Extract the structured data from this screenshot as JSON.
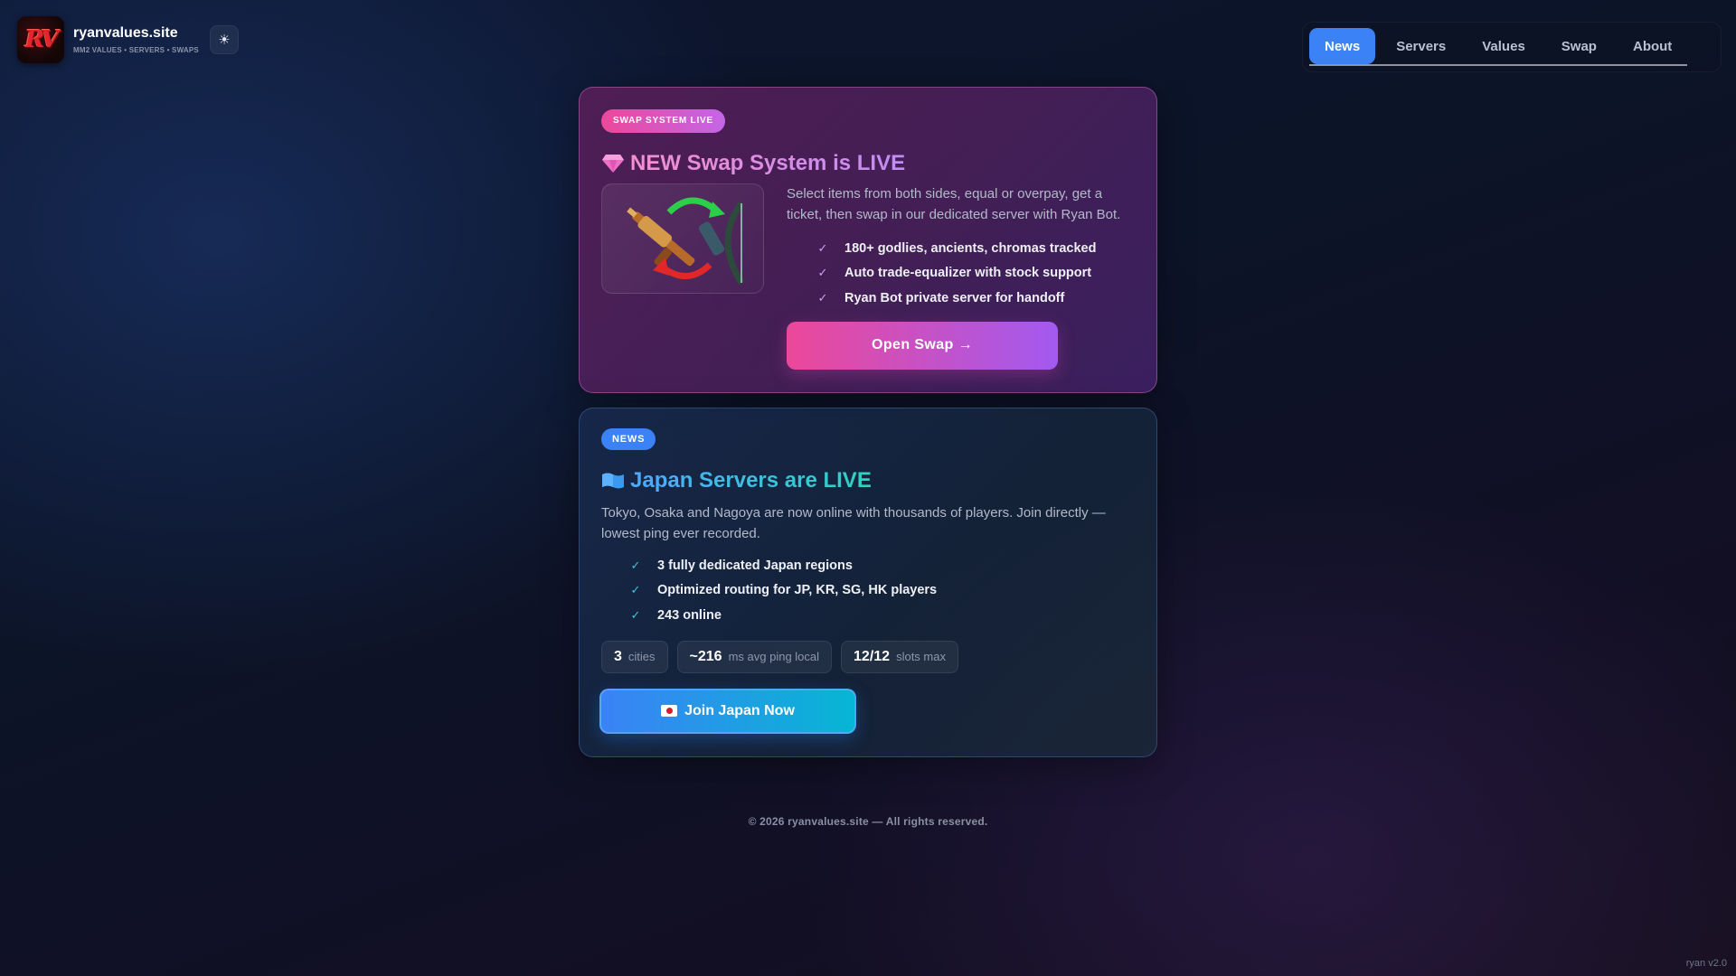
{
  "brand": {
    "logo_text": "RV",
    "name": "ryanvalues.site",
    "tagline": "MM2 VALUES • SERVERS • SWAPS",
    "theme_toggle_icon": "sun-icon"
  },
  "nav": {
    "items": [
      {
        "label": "News",
        "active": true
      },
      {
        "label": "Servers",
        "active": false
      },
      {
        "label": "Values",
        "active": false
      },
      {
        "label": "Swap",
        "active": false
      },
      {
        "label": "About",
        "active": false
      }
    ]
  },
  "swap_card": {
    "badge": "SWAP SYSTEM LIVE",
    "title_icon": "gem-icon",
    "title": "NEW Swap System is LIVE",
    "image": "weapons-swap-image",
    "description": "Select items from both sides, equal or overpay, get a ticket, then swap in our dedicated server with Ryan Bot.",
    "features": [
      "180+ godlies, ancients, chromas tracked",
      "Auto trade-equalizer with stock support",
      "Ryan Bot private server for handoff"
    ],
    "button": "Open Swap →"
  },
  "news_card": {
    "badge": "NEWS",
    "title_icon": "flag-icon",
    "title": "Japan Servers are LIVE",
    "description": "Tokyo, Osaka and Nagoya are now online with thousands of players. Join directly — lowest ping ever recorded.",
    "features": [
      "3 fully dedicated Japan regions",
      "Optimized routing for JP, KR, SG, HK players",
      "243 online"
    ],
    "stats": [
      {
        "value": "3",
        "label": "cities"
      },
      {
        "value": "~216",
        "label": "ms avg ping local"
      },
      {
        "value": "12/12",
        "label": "slots max"
      }
    ],
    "button": "Join Japan Now"
  },
  "footer": "© 2026 ryanvalues.site — All rights reserved.",
  "version": "ryan v2.0",
  "colors": {
    "accent_blue": "#3b82f6",
    "swap_pink": "#ec4899",
    "swap_purple": "#a25af0",
    "news_cyan": "#06b6d4"
  }
}
